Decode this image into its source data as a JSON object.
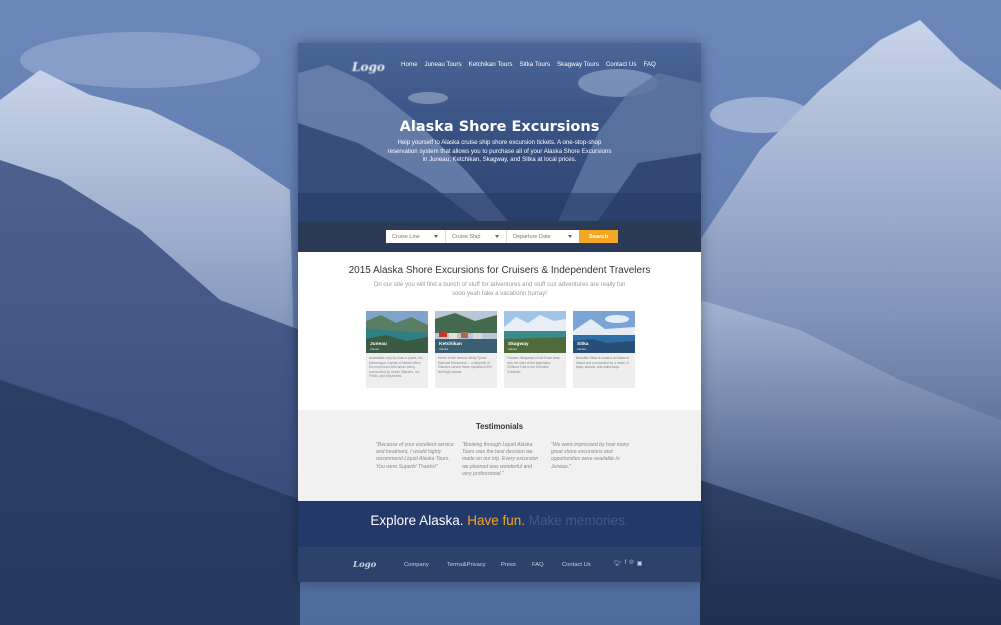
{
  "nav": {
    "logo": "Logo",
    "links": [
      "Home",
      "Juneau Tours",
      "Ketchikan Tours",
      "Sitka Tours",
      "Skagway Tours",
      "Contact Us",
      "FAQ"
    ]
  },
  "hero": {
    "title": "Alaska Shore Excursions",
    "subtitle": "Help yourself to Alaska cruise ship shore excursion tickets. A one-stop-shop reservation system that allows you to purchase all of your Alaska Shore Excursions in Juneau, Ketchikan, Skagway, and Sitka at local prices."
  },
  "search": {
    "cruise_line": "Cruise Line",
    "cruise_ship": "Cruise Ship",
    "departure_date": "Departure Date",
    "button": "Search"
  },
  "intro": {
    "title": "2015 Alaska Shore Excursions for Cruisers & Independent Travelers",
    "subtitle": "On our site you will find a bunch of stuff for adventures and stuff cuz adventures are really fun sooo yeah take a vacationn hurray!"
  },
  "cards": [
    {
      "name": "Juneau",
      "sub": "Alaska",
      "desc": "Accessible only by boat or plane, the picturesque Capital of Alaska offers the most tours with areas being surrounded by Green Glaciers, Ice Fields, and Mountains."
    },
    {
      "name": "Ketchikan",
      "sub": "Alaska",
      "desc": "Home to the famous Misty Fjords National Monument ... a labyrinth of Glaciers carved these mystical 6,000 feet high canals."
    },
    {
      "name": "Skagway",
      "sub": "Alaska",
      "desc": "Famous Skagway's Gold Rush town was the start of the legendary Chilkoot Trail to the Klondike Goldrush."
    },
    {
      "name": "Sitka",
      "sub": "Alaska",
      "desc": "Beautiful Sitka is located on Baranof Island and surrounded by a maze of bays, islands, and waterways."
    }
  ],
  "testimonials": {
    "title": "Testimonials",
    "quotes": [
      "\"Because of your excellent service and treatment, I would highly recommend Liquid Alaska Tours. You were Superb! Thanks!\"",
      "\"Booking through Liquid Alaska Tours was the best decision we made on our trip. Every excursion we planned was wonderful and very professional.\"",
      "\"We were impressed by how many great shore excursions and opportunities were available in Juneau.\""
    ]
  },
  "tagline": {
    "part1": "Explore Alaska.",
    "part2": "Have fun.",
    "part3": "Make memories."
  },
  "footer": {
    "logo": "Logo",
    "links": [
      "Company",
      "Terms&Privacy",
      "Press",
      "FAQ",
      "Contact Us"
    ],
    "social": [
      "twitter-icon",
      "facebook-icon",
      "pinterest-icon",
      "instagram-icon"
    ]
  },
  "colors": {
    "accent": "#f5a623",
    "navy": "#22396a",
    "footer": "#2d426a",
    "searchbar": "#2b3a57"
  }
}
